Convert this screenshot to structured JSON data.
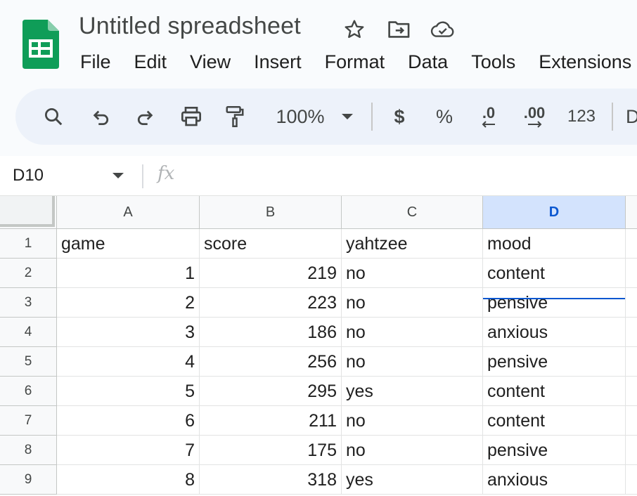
{
  "app": {
    "doc_title": "Untitled spreadsheet",
    "icons": [
      "sheets-logo-icon",
      "star-icon",
      "move-folder-icon",
      "cloud-saved-icon"
    ]
  },
  "menu": [
    "File",
    "Edit",
    "View",
    "Insert",
    "Format",
    "Data",
    "Tools",
    "Extensions"
  ],
  "toolbar": {
    "zoom": "100%",
    "currency_label": "$",
    "percent_label": "%",
    "decrease_decimal_label": ".0",
    "increase_decimal_label": ".00",
    "number_format_label": "123",
    "overflow_label": "D",
    "icons": [
      "search-icon",
      "undo-icon",
      "redo-icon",
      "print-icon",
      "paint-format-icon",
      "zoom-dropdown-icon"
    ]
  },
  "formula_bar": {
    "name_box": "D10",
    "fx_label": "fx",
    "formula_value": ""
  },
  "sheet": {
    "selected_column": "D",
    "columns": [
      "A",
      "B",
      "C",
      "D"
    ],
    "row_numbers": [
      "1",
      "2",
      "3",
      "4",
      "5",
      "6",
      "7",
      "8",
      "9"
    ],
    "rows": [
      [
        "game",
        "score",
        "yahtzee",
        "mood"
      ],
      [
        "1",
        "219",
        "no",
        "content"
      ],
      [
        "2",
        "223",
        "no",
        "pensive"
      ],
      [
        "3",
        "186",
        "no",
        "anxious"
      ],
      [
        "4",
        "256",
        "no",
        "pensive"
      ],
      [
        "5",
        "295",
        "yes",
        "content"
      ],
      [
        "6",
        "211",
        "no",
        "content"
      ],
      [
        "7",
        "175",
        "no",
        "pensive"
      ],
      [
        "8",
        "318",
        "yes",
        "anxious"
      ]
    ],
    "numeric_columns": [
      0,
      1
    ],
    "colors": {
      "selected_header_bg": "#d3e3fd",
      "selected_header_text": "#0b57d0",
      "active_cell_border": "#0b57d0",
      "sheets_green": "#0f9d58"
    }
  }
}
